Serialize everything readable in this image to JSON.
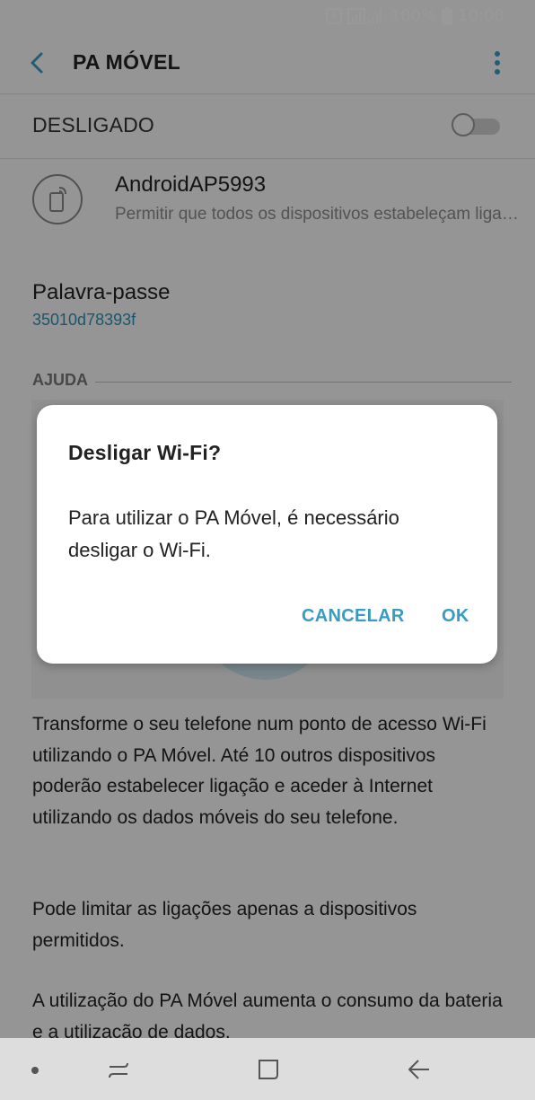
{
  "status_bar": {
    "sim_label": "1",
    "battery": "100%",
    "time": "10:00"
  },
  "app_bar": {
    "title": "PA MÓVEL",
    "back_icon": "chevron-left-icon",
    "more_icon": "more-vert-icon"
  },
  "toggle": {
    "label": "DESLIGADO",
    "state": "off"
  },
  "network": {
    "icon": "hotspot-icon",
    "name": "AndroidAP5993",
    "description": "Permitir que todos os dispositivos estabeleçam ligação"
  },
  "password": {
    "label": "Palavra-passe",
    "value": "35010d78393f"
  },
  "help": {
    "header": "AJUDA",
    "paragraphs": [
      "Transforme o seu telefone num ponto de acesso Wi-Fi utilizando o PA Móvel. Até 10 outros dispositivos poderão estabelecer ligação e aceder à Internet utilizando os dados móveis do seu telefone.",
      "Pode limitar as ligações apenas a dispositivos permitidos.",
      "A utilização do PA Móvel aumenta o consumo da bateria e a utilização de dados."
    ]
  },
  "dialog": {
    "title": "Desligar Wi-Fi?",
    "message": "Para utilizar o PA Móvel, é necessário desligar o Wi-Fi.",
    "cancel_label": "CANCELAR",
    "ok_label": "OK"
  },
  "nav_bar": {
    "icons": [
      "dot-icon",
      "recent-apps-icon",
      "home-icon",
      "back-arrow-icon"
    ]
  },
  "colors": {
    "accent": "#3a9bc2",
    "link": "#2f8fb5",
    "scrim": "rgba(0,0,0,0.4)"
  }
}
